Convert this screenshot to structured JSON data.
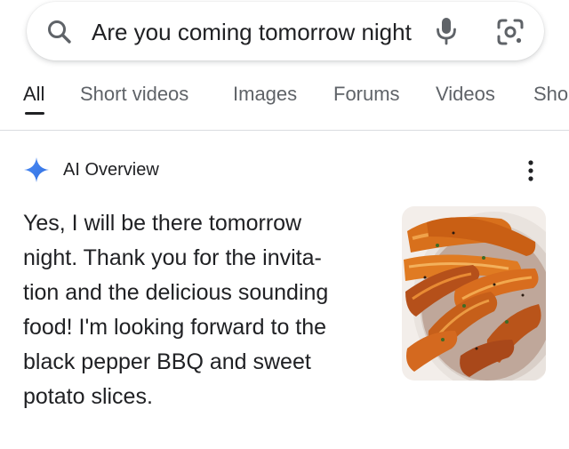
{
  "search": {
    "query": "Are you coming tomorrow night",
    "icons": {
      "search": "search-icon",
      "mic": "mic-icon",
      "lens": "lens-icon"
    }
  },
  "tabs": [
    {
      "label": "All",
      "active": true
    },
    {
      "label": "Short videos",
      "active": false
    },
    {
      "label": "Images",
      "active": false
    },
    {
      "label": "Forums",
      "active": false
    },
    {
      "label": "Videos",
      "active": false
    },
    {
      "label": "Sho",
      "active": false
    }
  ],
  "ai_overview": {
    "title": "AI Overview",
    "answer_lines": [
      "Yes, I will be there tomorrow",
      "night. Thank you for the invita-",
      "tion and the delicious sounding",
      "food! I'm looking forward to the",
      "black pepper BBQ and sweet",
      "potato slices."
    ],
    "icons": {
      "sparkle": "sparkle-icon",
      "more": "more-vert-icon"
    }
  },
  "colors": {
    "text_primary": "#202124",
    "text_secondary": "#5f6368",
    "divider": "#dadce0",
    "sparkle": "#4285f4"
  }
}
